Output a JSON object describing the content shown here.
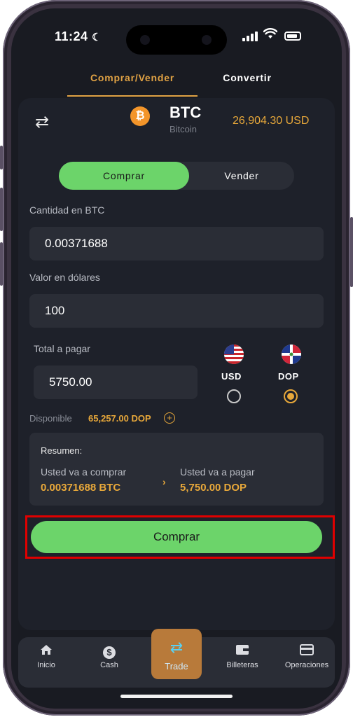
{
  "status_bar": {
    "time": "11:24"
  },
  "tabs": {
    "buy_sell": "Comprar/Vender",
    "convert": "Convertir"
  },
  "coin": {
    "symbol": "BTC",
    "name": "Bitcoin",
    "price": "26,904.30 USD",
    "icon_glyph": "₿"
  },
  "toggle": {
    "buy": "Comprar",
    "sell": "Vender"
  },
  "form": {
    "amount_label": "Cantidad en BTC",
    "amount_value": "0.00371688",
    "usd_label": "Valor en dólares",
    "usd_value": "100",
    "total_label": "Total a pagar",
    "total_value": "5750.00"
  },
  "currency": {
    "usd": "USD",
    "dop": "DOP",
    "selected": "DOP"
  },
  "available": {
    "label": "Disponible",
    "value": "65,257.00 DOP"
  },
  "summary": {
    "title": "Resumen:",
    "buy_label": "Usted va a comprar",
    "buy_value": "0.00371688 BTC",
    "pay_label": "Usted va a pagar",
    "pay_value": "5,750.00 DOP"
  },
  "cta": {
    "label": "Comprar"
  },
  "nav": {
    "home": "Inicio",
    "cash": "Cash",
    "trade": "Trade",
    "wallets": "Billeteras",
    "operations": "Operaciones"
  },
  "colors": {
    "accent": "#e8a83a",
    "green": "#6cd46a",
    "background": "#191b22",
    "highlight": "#e00000"
  }
}
